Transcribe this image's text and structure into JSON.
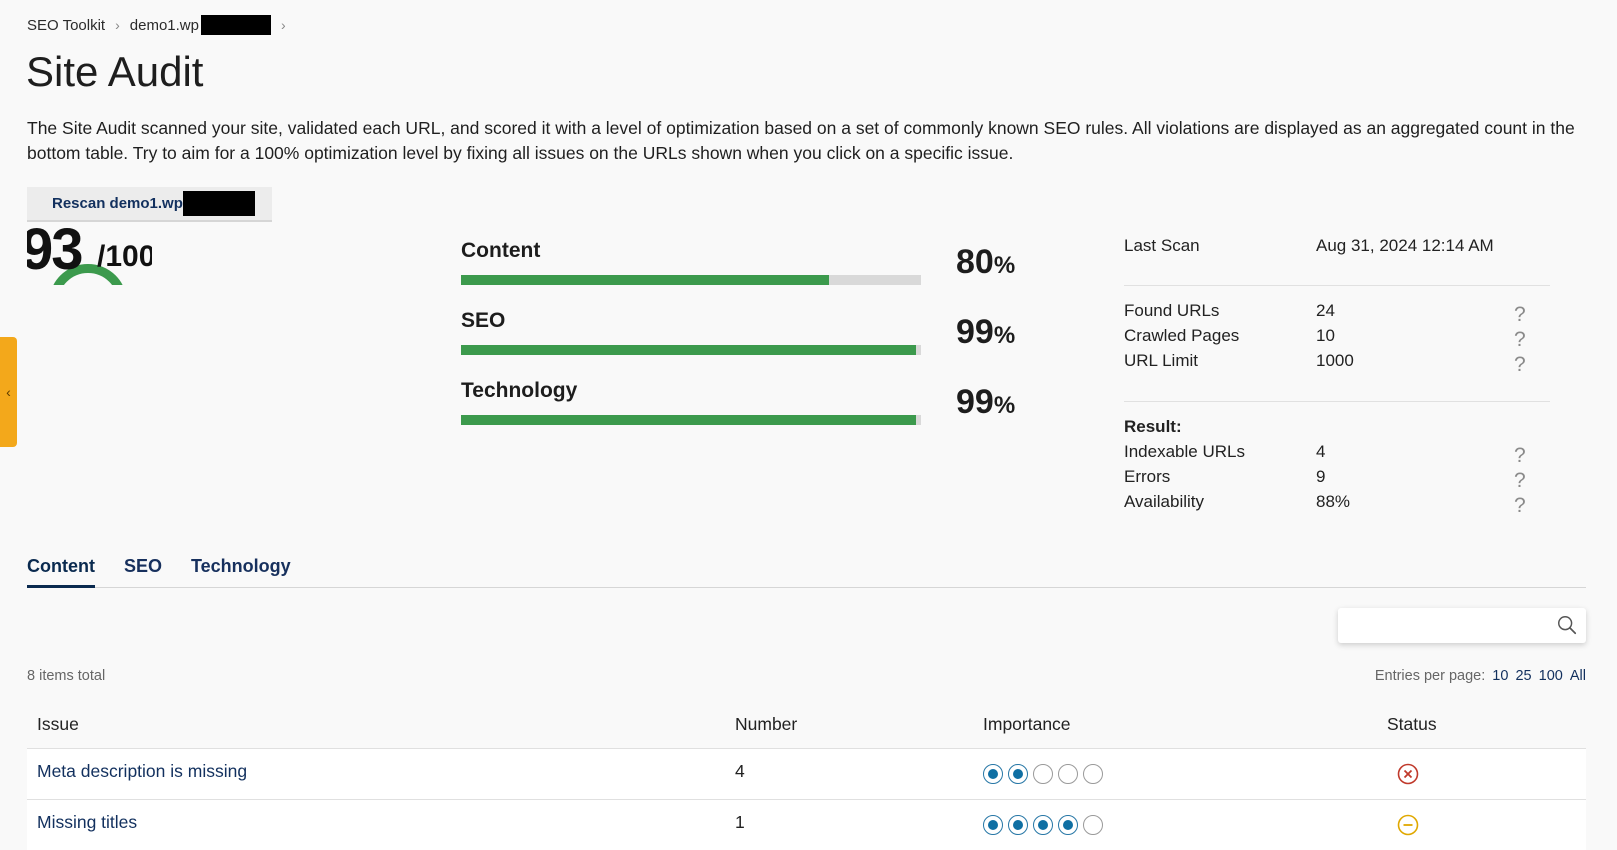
{
  "breadcrumb": {
    "root": "SEO Toolkit",
    "site": "demo1.wp"
  },
  "page": {
    "title": "Site Audit",
    "intro": "The Site Audit scanned your site, validated each URL, and scored it with a level of optimization based on a set of commonly known SEO rules. All violations are displayed as an aggregated count in the bottom table. Try to aim for a 100% optimization level by fixing all issues on the URLs shown when you click on a specific issue."
  },
  "rescan": {
    "label": "Rescan demo1.wp"
  },
  "score": {
    "value": "93",
    "max": "/100"
  },
  "categories": [
    {
      "label": "Content",
      "percent": 80,
      "display": "80"
    },
    {
      "label": "SEO",
      "percent": 99,
      "display": "99"
    },
    {
      "label": "Technology",
      "percent": 99,
      "display": "99"
    }
  ],
  "percent_sign": "%",
  "stats": {
    "last_scan_label": "Last Scan",
    "last_scan_value": "Aug 31, 2024 12:14 AM",
    "found_urls_label": "Found URLs",
    "found_urls_value": "24",
    "crawled_label": "Crawled Pages",
    "crawled_value": "10",
    "url_limit_label": "URL Limit",
    "url_limit_value": "1000",
    "result_label": "Result:",
    "indexable_label": "Indexable URLs",
    "indexable_value": "4",
    "errors_label": "Errors",
    "errors_value": "9",
    "availability_label": "Availability",
    "availability_value": "88%",
    "help": "?"
  },
  "tabs": [
    "Content",
    "SEO",
    "Technology"
  ],
  "search": {
    "placeholder": ""
  },
  "list": {
    "items_total": "8 items total",
    "entries_label": "Entries per page:",
    "entries_options": [
      "10",
      "25",
      "100",
      "All"
    ]
  },
  "table": {
    "headers": {
      "issue": "Issue",
      "number": "Number",
      "importance": "Importance",
      "status": "Status"
    },
    "rows": [
      {
        "issue": "Meta description is missing",
        "number": "4",
        "importance": 2,
        "status": "error"
      },
      {
        "issue": "Missing titles",
        "number": "1",
        "importance": 4,
        "status": "warning"
      }
    ]
  },
  "colors": {
    "accent_green": "#3c9a4d",
    "link_navy": "#12305e",
    "side_tab": "#f3a81b",
    "status_error": "#c0392b",
    "status_warning": "#e0a800"
  },
  "icons": {
    "side_tab": "chevron-left-icon",
    "search": "search-icon"
  }
}
